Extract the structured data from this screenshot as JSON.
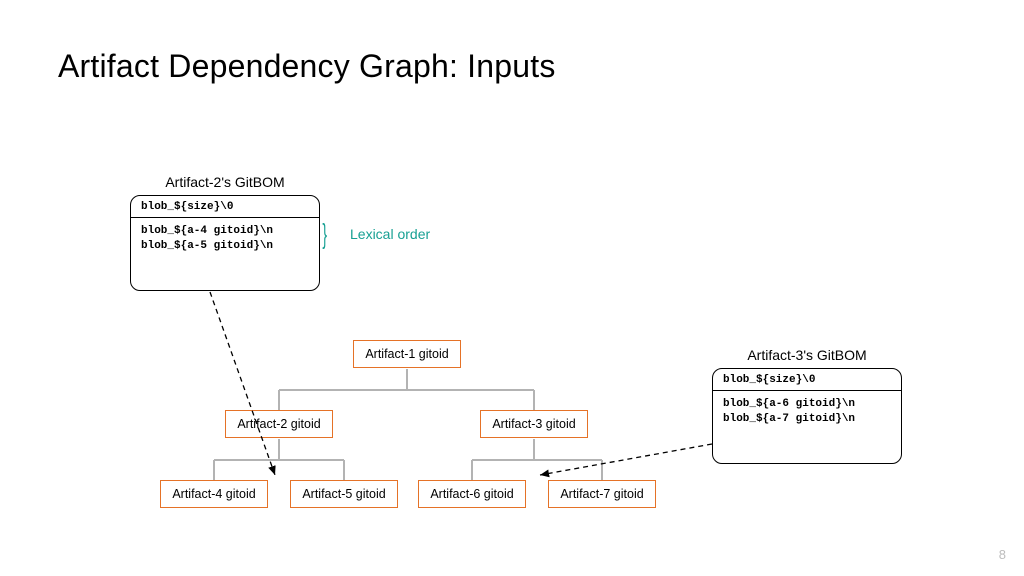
{
  "title": "Artifact Dependency Graph: Inputs",
  "page_number": "8",
  "lexical_label": "Lexical order",
  "gitbom2": {
    "title": "Artifact-2's GitBOM",
    "header": "blob_${size}\\0",
    "body": "blob_${a-4 gitoid}\\n\nblob_${a-5 gitoid}\\n"
  },
  "gitbom3": {
    "title": "Artifact-3's GitBOM",
    "header": "blob_${size}\\0",
    "body": "blob_${a-6 gitoid}\\n\nblob_${a-7 gitoid}\\n"
  },
  "nodes": {
    "a1": "Artifact-1 gitoid",
    "a2": "Artifact-2 gitoid",
    "a3": "Artifact-3 gitoid",
    "a4": "Artifact-4 gitoid",
    "a5": "Artifact-5 gitoid",
    "a6": "Artifact-6 gitoid",
    "a7": "Artifact-7 gitoid"
  },
  "chart_data": {
    "type": "tree",
    "title": "Artifact Dependency Graph: Inputs",
    "nodes": [
      {
        "id": "a1",
        "label": "Artifact-1 gitoid"
      },
      {
        "id": "a2",
        "label": "Artifact-2 gitoid"
      },
      {
        "id": "a3",
        "label": "Artifact-3 gitoid"
      },
      {
        "id": "a4",
        "label": "Artifact-4 gitoid"
      },
      {
        "id": "a5",
        "label": "Artifact-5 gitoid"
      },
      {
        "id": "a6",
        "label": "Artifact-6 gitoid"
      },
      {
        "id": "a7",
        "label": "Artifact-7 gitoid"
      }
    ],
    "edges": [
      {
        "from": "a1",
        "to": "a2"
      },
      {
        "from": "a1",
        "to": "a3"
      },
      {
        "from": "a2",
        "to": "a4"
      },
      {
        "from": "a2",
        "to": "a5"
      },
      {
        "from": "a3",
        "to": "a6"
      },
      {
        "from": "a3",
        "to": "a7"
      }
    ],
    "gitboms": [
      {
        "for": "a2",
        "header": "blob_${size}\\0",
        "entries": [
          "blob_${a-4 gitoid}\\n",
          "blob_${a-5 gitoid}\\n"
        ],
        "note": "Lexical order"
      },
      {
        "for": "a3",
        "header": "blob_${size}\\0",
        "entries": [
          "blob_${a-6 gitoid}\\n",
          "blob_${a-7 gitoid}\\n"
        ]
      }
    ],
    "colors": {
      "node_border": "#e57227",
      "edge": "#b3b3b3",
      "dashed": "#000000",
      "accent": "#17a093"
    }
  }
}
